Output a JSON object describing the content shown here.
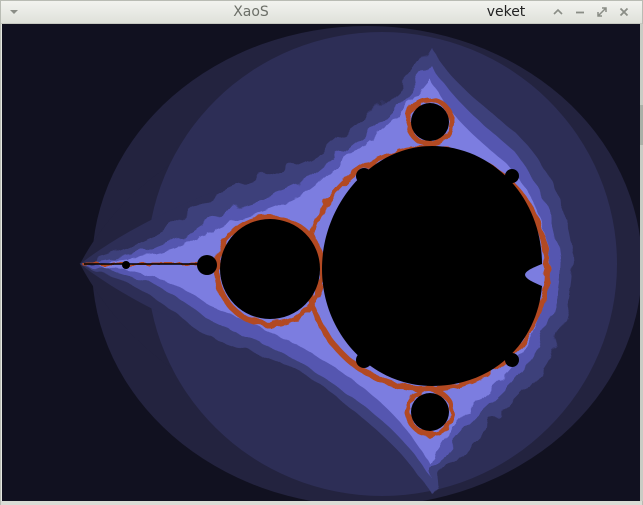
{
  "window": {
    "title": "XaoS",
    "workspace": "veket",
    "buttons": {
      "menu_icon": "chevron-down-icon",
      "minimize_icon": "minimize-icon",
      "maximize_icon": "maximize-icon",
      "close_icon": "close-icon"
    }
  },
  "fractal": {
    "type": "mandelbrot",
    "palette": {
      "background": "#111120",
      "outer_band": "#2a2a4a",
      "mid_band": "#4a4a86",
      "inner_band": "#7b7de0",
      "edge_glow": "#a67cff",
      "fringe": "#b24820",
      "set": "#000000"
    }
  }
}
